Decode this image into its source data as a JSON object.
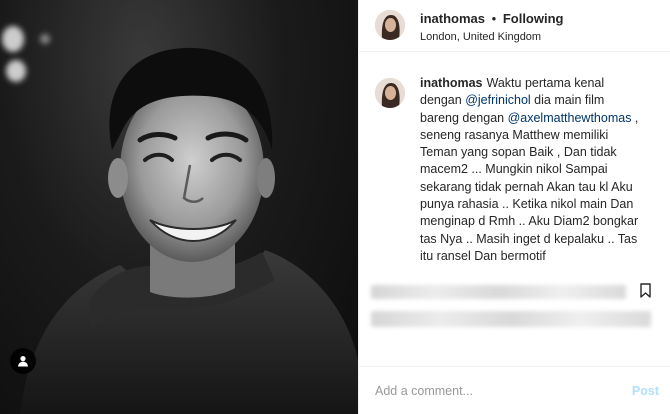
{
  "post": {
    "username": "inathomas",
    "separator": "•",
    "follow_status": "Following",
    "location": "London, United Kingdom"
  },
  "caption": {
    "username": "inathomas",
    "text_1": "Waktu pertama kenal dengan ",
    "mention_1": "@jefrinichol",
    "text_2": " dia main film bareng dengan ",
    "mention_2": "@axelmatthewthomas",
    "text_3": " , seneng rasanya Matthew memiliki Teman yang sopan Baik , Dan tidak macem2 ... Mungkin nikol Sampai sekarang tidak pernah Akan tau kl Aku punya rahasia .. Ketika nikol main Dan menginap d Rmh .. Aku Diam2 bongkar tas Nya .. Masih inget d kepalaku .. Tas itu ransel Dan bermotif"
  },
  "comment_box": {
    "placeholder": "Add a comment...",
    "post_label": "Post"
  },
  "icons": {
    "user_tag": "user-tag-icon",
    "bookmark": "bookmark-icon"
  },
  "colors": {
    "mention": "#003569",
    "post_disabled": "#b2dffc",
    "border": "#efefef"
  }
}
